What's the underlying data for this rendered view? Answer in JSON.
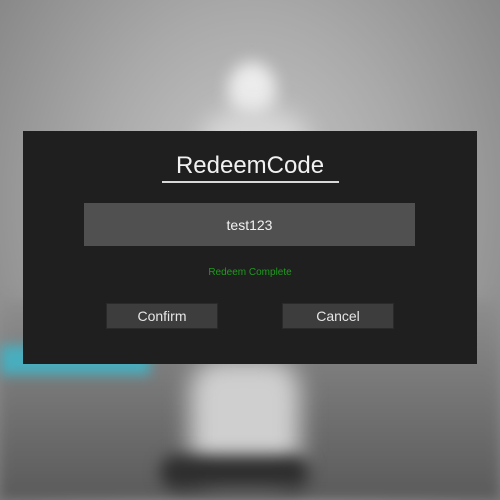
{
  "dialog": {
    "title": "RedeemCode",
    "code_value": "test123",
    "status_message": "Redeem Complete",
    "status_color": "#1f9a1f",
    "confirm_label": "Confirm",
    "cancel_label": "Cancel"
  }
}
